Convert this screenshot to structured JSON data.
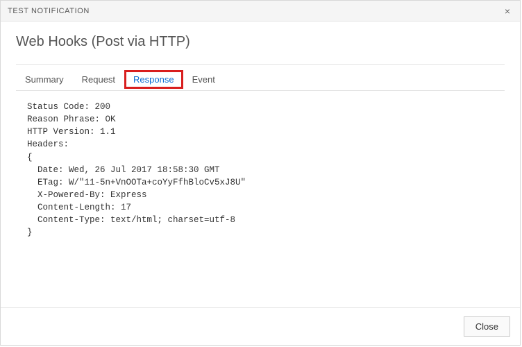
{
  "titlebar": {
    "title": "TEST NOTIFICATION",
    "close_aria": "Close"
  },
  "heading": "Web Hooks (Post via HTTP)",
  "tabs": {
    "summary": "Summary",
    "request": "Request",
    "response": "Response",
    "event": "Event",
    "active": "response"
  },
  "response_body": "Status Code: 200\nReason Phrase: OK\nHTTP Version: 1.1\nHeaders:\n{\n  Date: Wed, 26 Jul 2017 18:58:30 GMT\n  ETag: W/\"11-5n+VnOOTa+coYyFfhBloCv5xJ8U\"\n  X-Powered-By: Express\n  Content-Length: 17\n  Content-Type: text/html; charset=utf-8\n}",
  "footer": {
    "close_label": "Close"
  }
}
